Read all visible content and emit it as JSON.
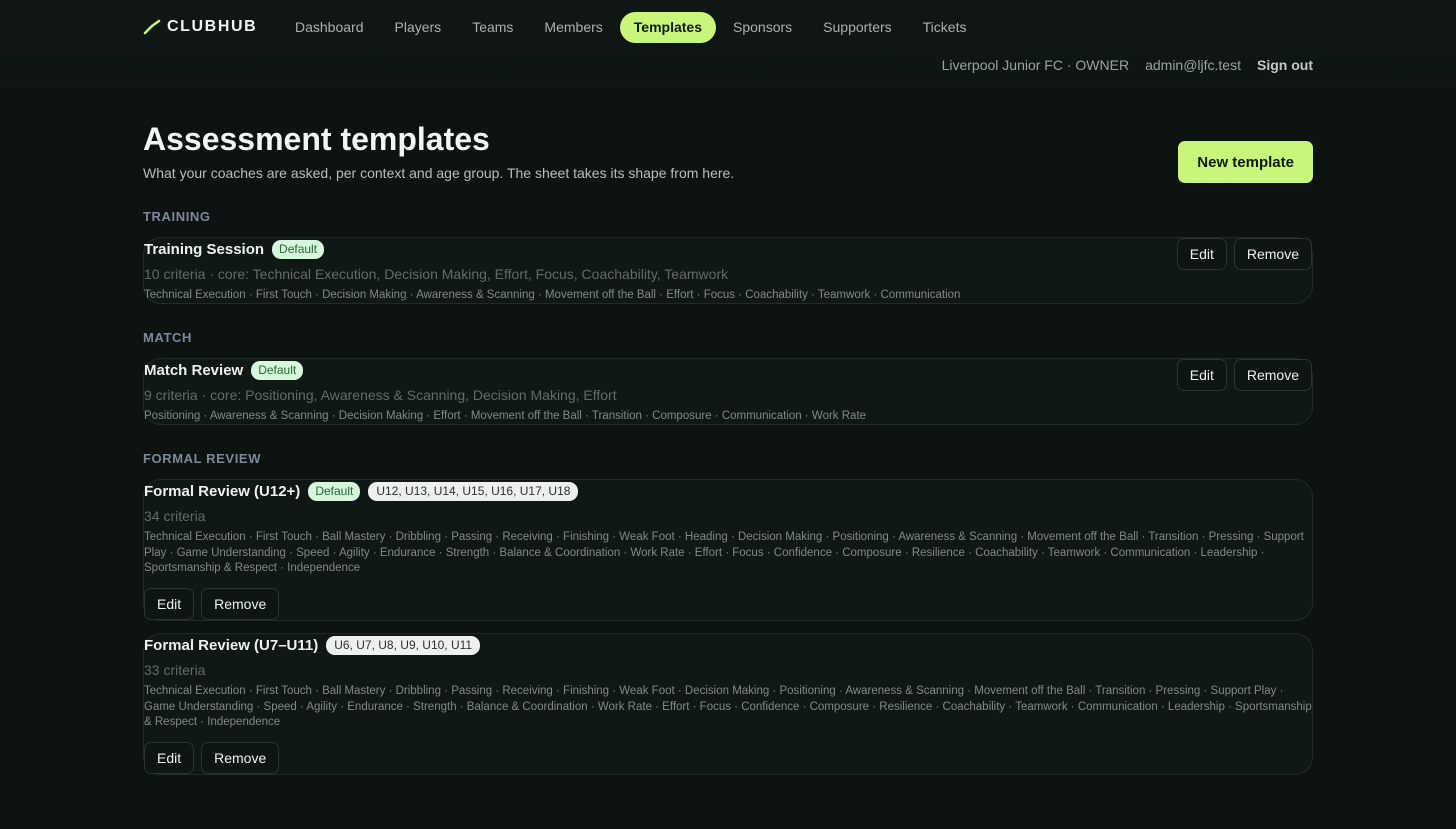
{
  "brand": {
    "name": "CLUBHUB",
    "accent": "#c8f57a"
  },
  "nav": [
    {
      "label": "Dashboard",
      "active": false
    },
    {
      "label": "Players",
      "active": false
    },
    {
      "label": "Teams",
      "active": false
    },
    {
      "label": "Members",
      "active": false
    },
    {
      "label": "Templates",
      "active": true
    },
    {
      "label": "Sponsors",
      "active": false
    },
    {
      "label": "Supporters",
      "active": false
    },
    {
      "label": "Tickets",
      "active": false
    }
  ],
  "user": {
    "club_role": "Liverpool Junior FC · OWNER",
    "email": "admin@ljfc.test",
    "sign_out": "Sign out"
  },
  "page": {
    "title": "Assessment templates",
    "subtitle": "What your coaches are asked, per context and age group. The sheet takes its shape from here.",
    "new_button": "New template"
  },
  "labels": {
    "edit": "Edit",
    "remove": "Remove",
    "default": "Default"
  },
  "sections": [
    {
      "heading": "TRAINING",
      "templates": [
        {
          "title": "Training Session",
          "default": true,
          "meta": "10 criteria · core: Technical Execution, Decision Making, Effort, Focus, Coachability, Teamwork",
          "criteria": "Technical Execution · First Touch · Decision Making · Awareness & Scanning · Movement off the Ball · Effort · Focus · Coachability · Teamwork · Communication"
        }
      ]
    },
    {
      "heading": "MATCH",
      "templates": [
        {
          "title": "Match Review",
          "default": true,
          "meta": "9 criteria · core: Positioning, Awareness & Scanning, Decision Making, Effort",
          "criteria": "Positioning · Awareness & Scanning · Decision Making · Effort · Movement off the Ball · Transition · Composure · Communication · Work Rate"
        }
      ]
    },
    {
      "heading": "FORMAL REVIEW",
      "templates": [
        {
          "title": "Formal Review (U12+)",
          "default": true,
          "ages": "U12, U13, U14, U15, U16, U17, U18",
          "meta": "34 criteria",
          "criteria": "Technical Execution · First Touch · Ball Mastery · Dribbling · Passing · Receiving · Finishing · Weak Foot · Heading · Decision Making · Positioning · Awareness & Scanning · Movement off the Ball · Transition · Pressing · Support Play · Game Understanding · Speed · Agility · Endurance · Strength · Balance & Coordination · Work Rate · Effort · Focus · Confidence · Composure · Resilience · Coachability · Teamwork · Communication · Leadership · Sportsmanship & Respect · Independence"
        },
        {
          "title": "Formal Review (U7–U11)",
          "default": false,
          "ages": "U6, U7, U8, U9, U10, U11",
          "meta": "33 criteria",
          "criteria": "Technical Execution · First Touch · Ball Mastery · Dribbling · Passing · Receiving · Finishing · Weak Foot · Decision Making · Positioning · Awareness & Scanning · Movement off the Ball · Transition · Pressing · Support Play · Game Understanding · Speed · Agility · Endurance · Strength · Balance & Coordination · Work Rate · Effort · Focus · Confidence · Composure · Resilience · Coachability · Teamwork · Communication · Leadership · Sportsmanship & Respect · Independence"
        }
      ]
    }
  ]
}
